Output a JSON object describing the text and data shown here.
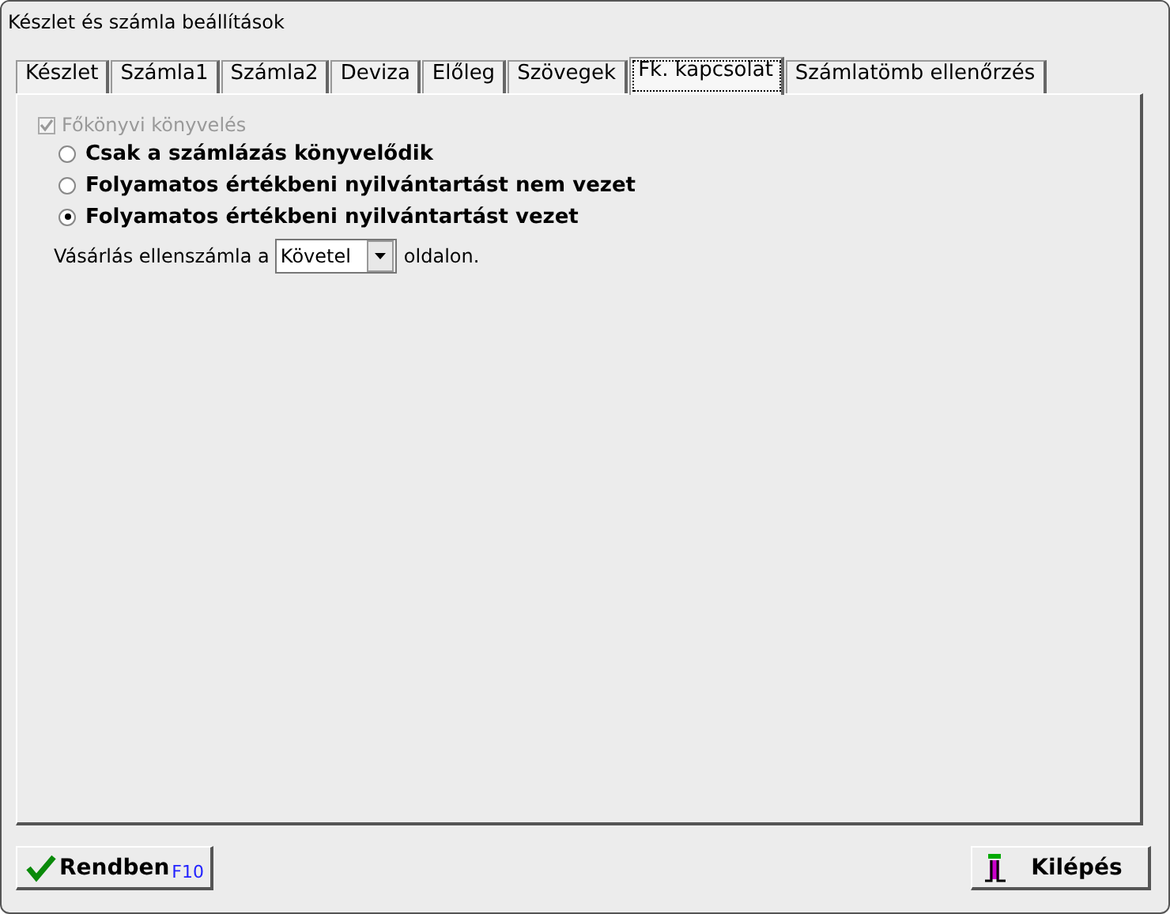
{
  "window": {
    "title": "Készlet és számla beállítások"
  },
  "tabs": [
    {
      "label": "Készlet",
      "selected": false
    },
    {
      "label": "Számla1",
      "selected": false
    },
    {
      "label": "Számla2",
      "selected": false
    },
    {
      "label": "Deviza",
      "selected": false
    },
    {
      "label": "Előleg",
      "selected": false
    },
    {
      "label": "Szövegek",
      "selected": false
    },
    {
      "label": "Fk. kapcsolat",
      "selected": true
    },
    {
      "label": "Számlatömb ellenőrzés",
      "selected": false
    }
  ],
  "ledger_checkbox": {
    "label": "Főkönyvi könyvelés",
    "checked": true,
    "disabled": true
  },
  "options": [
    {
      "label": "Csak a számlázás könyvelődik",
      "selected": false
    },
    {
      "label": "Folyamatos értékbeni nyilvántartást nem vezet",
      "selected": false
    },
    {
      "label": "Folyamatos értékbeni nyilvántartást vezet",
      "selected": true
    }
  ],
  "purchase_line": {
    "before": "Vásárlás ellenszámla a",
    "value": "Követel",
    "after": "oldalon."
  },
  "buttons": [
    {
      "kind": "ok",
      "label": "Rendben",
      "hotkey": "F10"
    },
    {
      "kind": "exit",
      "label": "Kilépés"
    }
  ]
}
